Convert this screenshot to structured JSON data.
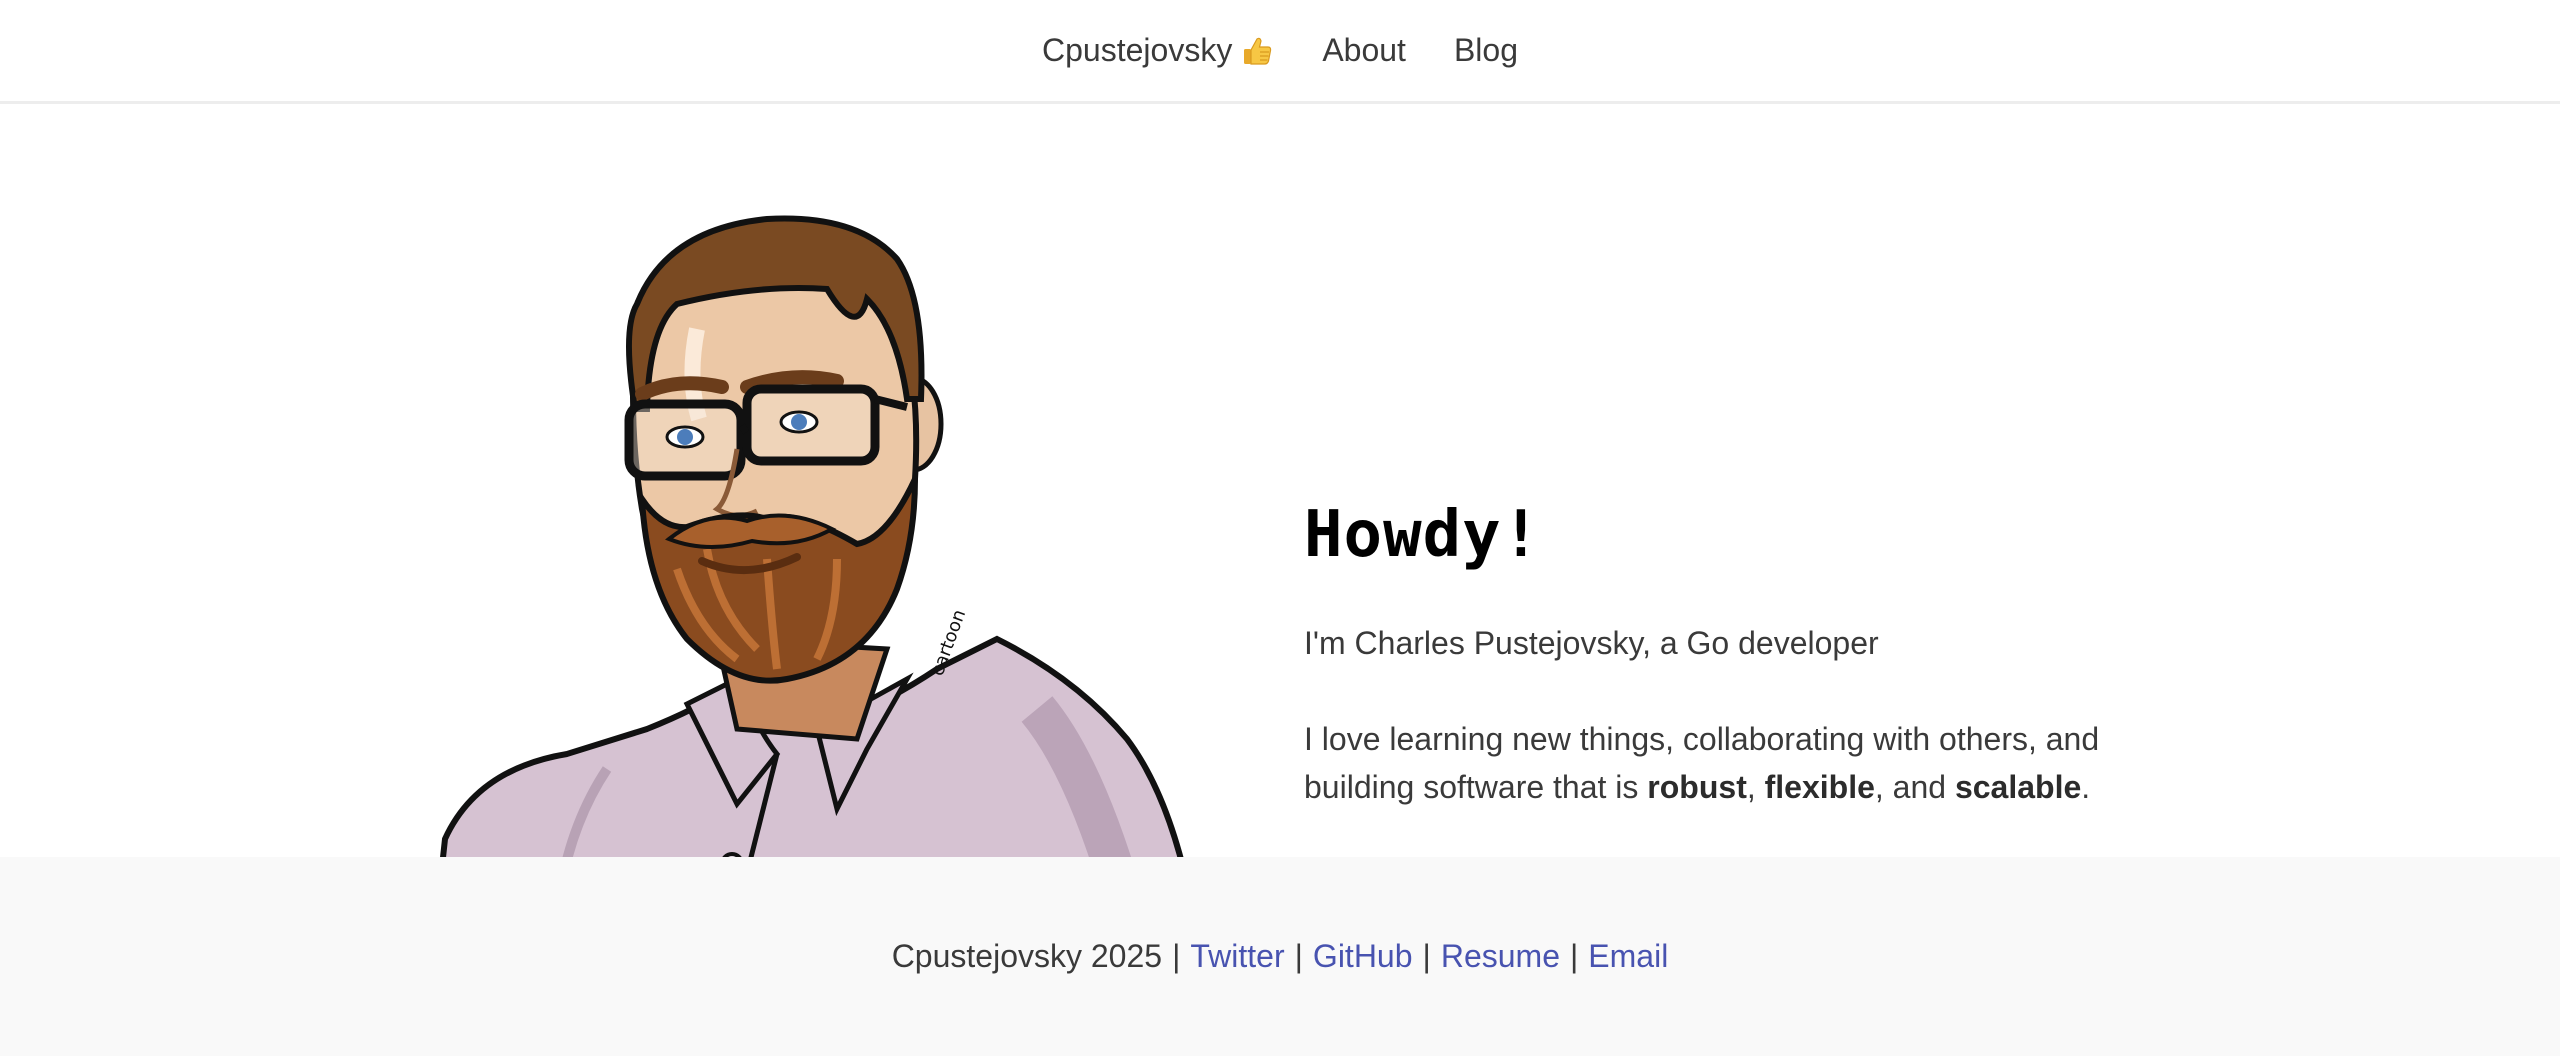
{
  "nav": {
    "brand": "Cpustejovsky",
    "brand_icon": "thumbs-up-icon",
    "links": [
      "About",
      "Blog"
    ]
  },
  "hero": {
    "portrait_icon": "avatar-illustration",
    "heading": "Howdy!",
    "intro": "I'm Charles Pustejovsky, a Go developer",
    "bio": {
      "prefix": "I love learning new things, collaborating with others, and building software that is",
      "word1": "robust",
      "sep1": ",",
      "word2": "flexible",
      "sep2": ", and",
      "word3": "scalable",
      "end": "."
    }
  },
  "footer": {
    "copyright": "Cpustejovsky 2025",
    "separator": "|",
    "links": [
      "Twitter",
      "GitHub",
      "Resume",
      "Email"
    ],
    "link_color": "#4853b0"
  }
}
